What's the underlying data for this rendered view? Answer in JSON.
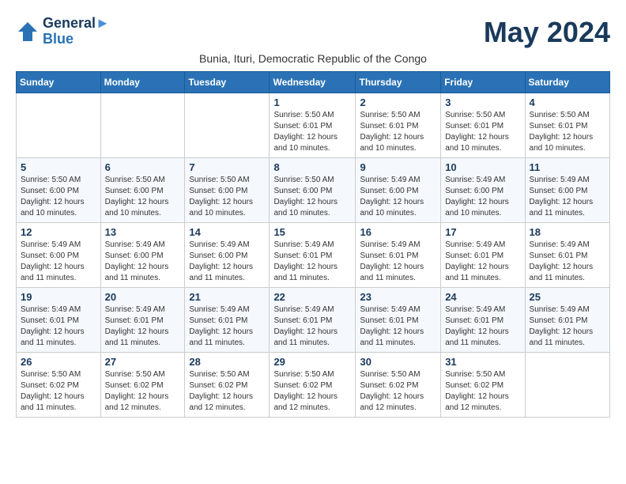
{
  "logo": {
    "line1": "General",
    "line2": "Blue"
  },
  "title": "May 2024",
  "subtitle": "Bunia, Ituri, Democratic Republic of the Congo",
  "weekdays": [
    "Sunday",
    "Monday",
    "Tuesday",
    "Wednesday",
    "Thursday",
    "Friday",
    "Saturday"
  ],
  "weeks": [
    [
      {
        "day": "",
        "info": ""
      },
      {
        "day": "",
        "info": ""
      },
      {
        "day": "",
        "info": ""
      },
      {
        "day": "1",
        "info": "Sunrise: 5:50 AM\nSunset: 6:01 PM\nDaylight: 12 hours\nand 10 minutes."
      },
      {
        "day": "2",
        "info": "Sunrise: 5:50 AM\nSunset: 6:01 PM\nDaylight: 12 hours\nand 10 minutes."
      },
      {
        "day": "3",
        "info": "Sunrise: 5:50 AM\nSunset: 6:01 PM\nDaylight: 12 hours\nand 10 minutes."
      },
      {
        "day": "4",
        "info": "Sunrise: 5:50 AM\nSunset: 6:01 PM\nDaylight: 12 hours\nand 10 minutes."
      }
    ],
    [
      {
        "day": "5",
        "info": "Sunrise: 5:50 AM\nSunset: 6:00 PM\nDaylight: 12 hours\nand 10 minutes."
      },
      {
        "day": "6",
        "info": "Sunrise: 5:50 AM\nSunset: 6:00 PM\nDaylight: 12 hours\nand 10 minutes."
      },
      {
        "day": "7",
        "info": "Sunrise: 5:50 AM\nSunset: 6:00 PM\nDaylight: 12 hours\nand 10 minutes."
      },
      {
        "day": "8",
        "info": "Sunrise: 5:50 AM\nSunset: 6:00 PM\nDaylight: 12 hours\nand 10 minutes."
      },
      {
        "day": "9",
        "info": "Sunrise: 5:49 AM\nSunset: 6:00 PM\nDaylight: 12 hours\nand 10 minutes."
      },
      {
        "day": "10",
        "info": "Sunrise: 5:49 AM\nSunset: 6:00 PM\nDaylight: 12 hours\nand 10 minutes."
      },
      {
        "day": "11",
        "info": "Sunrise: 5:49 AM\nSunset: 6:00 PM\nDaylight: 12 hours\nand 11 minutes."
      }
    ],
    [
      {
        "day": "12",
        "info": "Sunrise: 5:49 AM\nSunset: 6:00 PM\nDaylight: 12 hours\nand 11 minutes."
      },
      {
        "day": "13",
        "info": "Sunrise: 5:49 AM\nSunset: 6:00 PM\nDaylight: 12 hours\nand 11 minutes."
      },
      {
        "day": "14",
        "info": "Sunrise: 5:49 AM\nSunset: 6:00 PM\nDaylight: 12 hours\nand 11 minutes."
      },
      {
        "day": "15",
        "info": "Sunrise: 5:49 AM\nSunset: 6:01 PM\nDaylight: 12 hours\nand 11 minutes."
      },
      {
        "day": "16",
        "info": "Sunrise: 5:49 AM\nSunset: 6:01 PM\nDaylight: 12 hours\nand 11 minutes."
      },
      {
        "day": "17",
        "info": "Sunrise: 5:49 AM\nSunset: 6:01 PM\nDaylight: 12 hours\nand 11 minutes."
      },
      {
        "day": "18",
        "info": "Sunrise: 5:49 AM\nSunset: 6:01 PM\nDaylight: 12 hours\nand 11 minutes."
      }
    ],
    [
      {
        "day": "19",
        "info": "Sunrise: 5:49 AM\nSunset: 6:01 PM\nDaylight: 12 hours\nand 11 minutes."
      },
      {
        "day": "20",
        "info": "Sunrise: 5:49 AM\nSunset: 6:01 PM\nDaylight: 12 hours\nand 11 minutes."
      },
      {
        "day": "21",
        "info": "Sunrise: 5:49 AM\nSunset: 6:01 PM\nDaylight: 12 hours\nand 11 minutes."
      },
      {
        "day": "22",
        "info": "Sunrise: 5:49 AM\nSunset: 6:01 PM\nDaylight: 12 hours\nand 11 minutes."
      },
      {
        "day": "23",
        "info": "Sunrise: 5:49 AM\nSunset: 6:01 PM\nDaylight: 12 hours\nand 11 minutes."
      },
      {
        "day": "24",
        "info": "Sunrise: 5:49 AM\nSunset: 6:01 PM\nDaylight: 12 hours\nand 11 minutes."
      },
      {
        "day": "25",
        "info": "Sunrise: 5:49 AM\nSunset: 6:01 PM\nDaylight: 12 hours\nand 11 minutes."
      }
    ],
    [
      {
        "day": "26",
        "info": "Sunrise: 5:50 AM\nSunset: 6:02 PM\nDaylight: 12 hours\nand 11 minutes."
      },
      {
        "day": "27",
        "info": "Sunrise: 5:50 AM\nSunset: 6:02 PM\nDaylight: 12 hours\nand 12 minutes."
      },
      {
        "day": "28",
        "info": "Sunrise: 5:50 AM\nSunset: 6:02 PM\nDaylight: 12 hours\nand 12 minutes."
      },
      {
        "day": "29",
        "info": "Sunrise: 5:50 AM\nSunset: 6:02 PM\nDaylight: 12 hours\nand 12 minutes."
      },
      {
        "day": "30",
        "info": "Sunrise: 5:50 AM\nSunset: 6:02 PM\nDaylight: 12 hours\nand 12 minutes."
      },
      {
        "day": "31",
        "info": "Sunrise: 5:50 AM\nSunset: 6:02 PM\nDaylight: 12 hours\nand 12 minutes."
      },
      {
        "day": "",
        "info": ""
      }
    ]
  ]
}
